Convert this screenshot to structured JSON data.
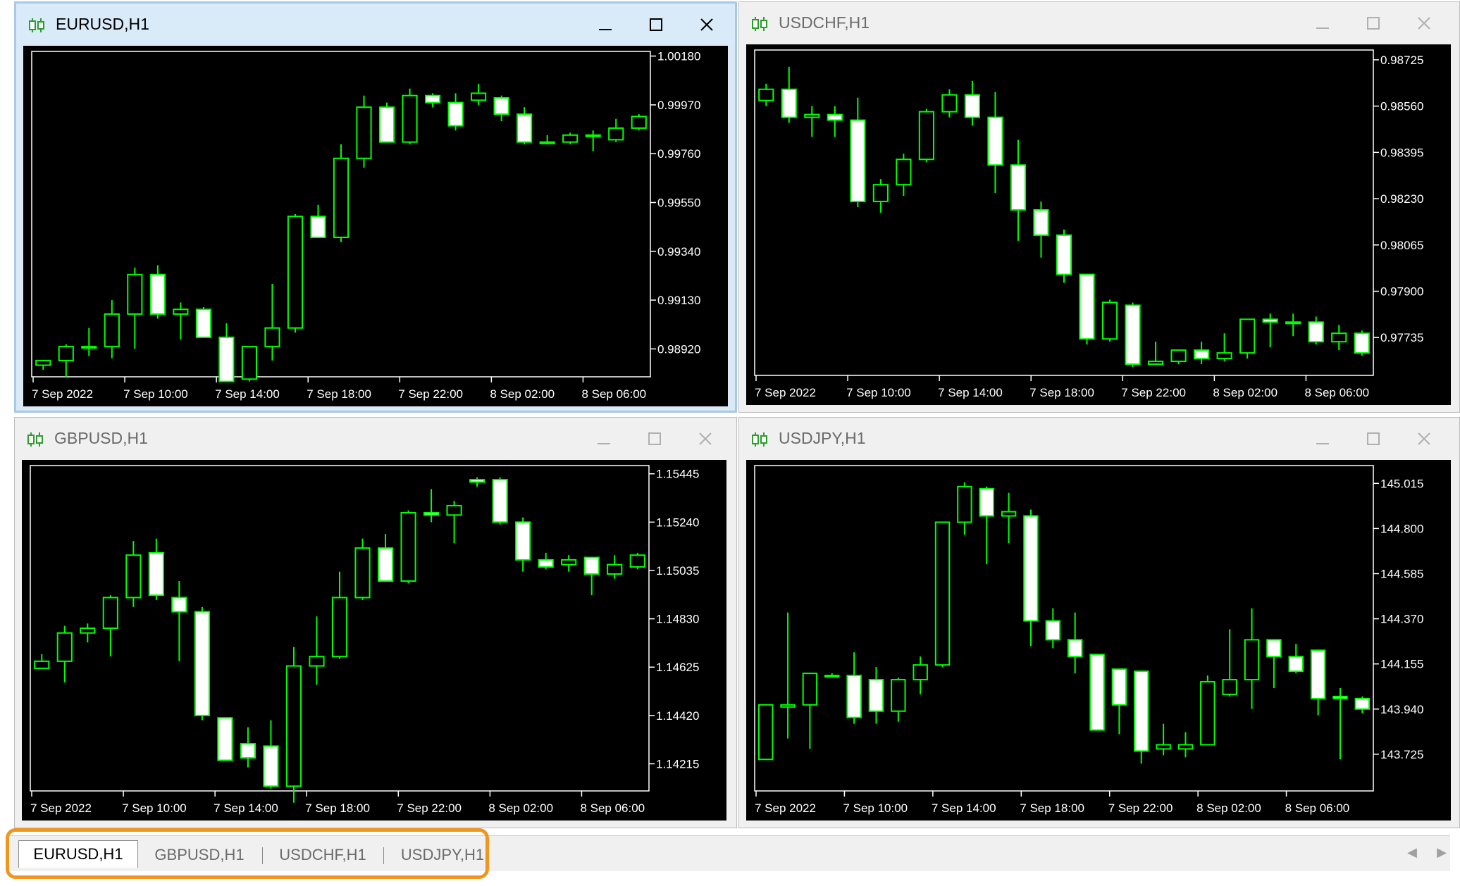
{
  "windows": [
    {
      "id": "eurusd",
      "title": "EURUSD,H1",
      "active": true,
      "price_labels": [
        "1.00180",
        "0.99970",
        "0.99760",
        "0.99550",
        "0.99340",
        "0.99130",
        "0.98920"
      ],
      "time_labels": [
        "7 Sep 2022",
        "7 Sep 10:00",
        "7 Sep 14:00",
        "7 Sep 18:00",
        "7 Sep 22:00",
        "8 Sep 02:00",
        "8 Sep 06:00"
      ],
      "chart_data": {
        "type": "candlestick",
        "y_axis": [
          0.988,
          1.002
        ],
        "candles": [
          [
            0.9885,
            0.9887,
            0.9883,
            0.9887
          ],
          [
            0.9887,
            0.9894,
            0.988,
            0.9893
          ],
          [
            0.9893,
            0.9901,
            0.9889,
            0.9893
          ],
          [
            0.9893,
            0.9913,
            0.9888,
            0.9907
          ],
          [
            0.9907,
            0.9927,
            0.9892,
            0.9924
          ],
          [
            0.9924,
            0.9928,
            0.9905,
            0.9907
          ],
          [
            0.9907,
            0.9912,
            0.9896,
            0.9909
          ],
          [
            0.9909,
            0.991,
            0.9897,
            0.9897
          ],
          [
            0.9897,
            0.9903,
            0.9878,
            0.9878
          ],
          [
            0.9879,
            0.9893,
            0.9878,
            0.9893
          ],
          [
            0.9893,
            0.992,
            0.9887,
            0.9901
          ],
          [
            0.9901,
            0.995,
            0.9899,
            0.9949
          ],
          [
            0.9949,
            0.9954,
            0.994,
            0.994
          ],
          [
            0.994,
            0.998,
            0.9938,
            0.9974
          ],
          [
            0.9974,
            1.0001,
            0.997,
            0.9996
          ],
          [
            0.9996,
            0.9998,
            0.9981,
            0.9981
          ],
          [
            0.9981,
            1.0004,
            0.998,
            1.0001
          ],
          [
            1.0001,
            1.0002,
            0.9996,
            0.9998
          ],
          [
            0.9998,
            1.0002,
            0.9986,
            0.9988
          ],
          [
            0.9999,
            1.0006,
            0.9997,
            1.0002
          ],
          [
            1.0,
            1.0001,
            0.999,
            0.9993
          ],
          [
            0.9993,
            0.9996,
            0.998,
            0.9981
          ],
          [
            0.9981,
            0.9984,
            0.998,
            0.9981
          ],
          [
            0.9981,
            0.9985,
            0.998,
            0.9984
          ],
          [
            0.9984,
            0.9986,
            0.9977,
            0.9984
          ],
          [
            0.9982,
            0.9991,
            0.9981,
            0.9987
          ],
          [
            0.9987,
            0.9993,
            0.9986,
            0.9992
          ]
        ]
      }
    },
    {
      "id": "usdchf",
      "title": "USDCHF,H1",
      "active": false,
      "price_labels": [
        "0.98725",
        "0.98560",
        "0.98395",
        "0.98230",
        "0.98065",
        "0.97900",
        "0.97735"
      ],
      "time_labels": [
        "7 Sep 2022",
        "7 Sep 10:00",
        "7 Sep 14:00",
        "7 Sep 18:00",
        "7 Sep 22:00",
        "8 Sep 02:00",
        "8 Sep 06:00"
      ],
      "chart_data": {
        "type": "candlestick",
        "y_axis": [
          0.976,
          0.9876
        ],
        "candles": [
          [
            0.9858,
            0.9864,
            0.9856,
            0.9862
          ],
          [
            0.9862,
            0.987,
            0.985,
            0.9852
          ],
          [
            0.9852,
            0.9856,
            0.9845,
            0.9853
          ],
          [
            0.9853,
            0.9856,
            0.9845,
            0.9851
          ],
          [
            0.9851,
            0.9859,
            0.982,
            0.9822
          ],
          [
            0.9822,
            0.983,
            0.9818,
            0.9828
          ],
          [
            0.9828,
            0.9839,
            0.9824,
            0.9837
          ],
          [
            0.9837,
            0.9855,
            0.9836,
            0.9854
          ],
          [
            0.9854,
            0.9862,
            0.9852,
            0.986
          ],
          [
            0.986,
            0.9865,
            0.9849,
            0.9852
          ],
          [
            0.9852,
            0.9861,
            0.9825,
            0.9835
          ],
          [
            0.9835,
            0.9844,
            0.9808,
            0.9819
          ],
          [
            0.9819,
            0.9822,
            0.9802,
            0.981
          ],
          [
            0.981,
            0.9812,
            0.9793,
            0.9796
          ],
          [
            0.9796,
            0.9796,
            0.9771,
            0.9773
          ],
          [
            0.9773,
            0.9787,
            0.9772,
            0.9786
          ],
          [
            0.9785,
            0.9786,
            0.9763,
            0.9764
          ],
          [
            0.9764,
            0.9772,
            0.9764,
            0.9765
          ],
          [
            0.9765,
            0.9769,
            0.9764,
            0.9769
          ],
          [
            0.9769,
            0.9772,
            0.9764,
            0.9766
          ],
          [
            0.9766,
            0.9775,
            0.9765,
            0.9768
          ],
          [
            0.9768,
            0.978,
            0.9766,
            0.978
          ],
          [
            0.978,
            0.9782,
            0.977,
            0.9779
          ],
          [
            0.9779,
            0.9782,
            0.9774,
            0.9779
          ],
          [
            0.9779,
            0.9781,
            0.9771,
            0.9772
          ],
          [
            0.9772,
            0.9778,
            0.9769,
            0.9775
          ],
          [
            0.9775,
            0.9776,
            0.9767,
            0.9768
          ]
        ]
      }
    },
    {
      "id": "gbpusd",
      "title": "GBPUSD,H1",
      "active": false,
      "price_labels": [
        "1.15445",
        "1.15240",
        "1.15035",
        "1.14830",
        "1.14625",
        "1.14420",
        "1.14215"
      ],
      "time_labels": [
        "7 Sep 2022",
        "7 Sep 10:00",
        "7 Sep 14:00",
        "7 Sep 18:00",
        "7 Sep 22:00",
        "8 Sep 02:00",
        "8 Sep 06:00"
      ],
      "chart_data": {
        "type": "candlestick",
        "y_axis": [
          1.141,
          1.1548
        ],
        "candles": [
          [
            1.1462,
            1.1468,
            1.1462,
            1.1465
          ],
          [
            1.1465,
            1.148,
            1.1456,
            1.1477
          ],
          [
            1.1477,
            1.1481,
            1.1473,
            1.1479
          ],
          [
            1.1479,
            1.1493,
            1.1467,
            1.1492
          ],
          [
            1.1492,
            1.1516,
            1.1488,
            1.151
          ],
          [
            1.1511,
            1.1517,
            1.1491,
            1.1493
          ],
          [
            1.1492,
            1.1499,
            1.1465,
            1.1486
          ],
          [
            1.1486,
            1.1488,
            1.144,
            1.1442
          ],
          [
            1.1441,
            1.143,
            1.1423,
            1.1423
          ],
          [
            1.143,
            1.1437,
            1.142,
            1.1424
          ],
          [
            1.1429,
            1.144,
            1.1411,
            1.1412
          ],
          [
            1.1412,
            1.1471,
            1.1405,
            1.1463
          ],
          [
            1.1463,
            1.1484,
            1.1455,
            1.1467
          ],
          [
            1.1467,
            1.1503,
            1.1466,
            1.1492
          ],
          [
            1.1492,
            1.1517,
            1.1491,
            1.1513
          ],
          [
            1.1513,
            1.1519,
            1.1499,
            1.1499
          ],
          [
            1.1499,
            1.1529,
            1.1498,
            1.1528
          ],
          [
            1.1528,
            1.1538,
            1.1524,
            1.1527
          ],
          [
            1.1527,
            1.1533,
            1.1515,
            1.1531
          ],
          [
            1.1542,
            1.1543,
            1.1539,
            1.1541
          ],
          [
            1.1542,
            1.1543,
            1.1523,
            1.1524
          ],
          [
            1.1524,
            1.1526,
            1.1503,
            1.1508
          ],
          [
            1.1508,
            1.1511,
            1.1504,
            1.1505
          ],
          [
            1.1506,
            1.151,
            1.1503,
            1.1508
          ],
          [
            1.1509,
            1.1509,
            1.1493,
            1.1502
          ],
          [
            1.1502,
            1.151,
            1.15,
            1.1506
          ],
          [
            1.1505,
            1.1511,
            1.1504,
            1.151
          ]
        ]
      }
    },
    {
      "id": "usdjpy",
      "title": "USDJPY,H1",
      "active": false,
      "price_labels": [
        "145.015",
        "144.800",
        "144.585",
        "144.370",
        "144.155",
        "143.940",
        "143.725"
      ],
      "time_labels": [
        "7 Sep 2022",
        "7 Sep 10:00",
        "7 Sep 14:00",
        "7 Sep 18:00",
        "7 Sep 22:00",
        "8 Sep 02:00",
        "8 Sep 06:00"
      ],
      "chart_data": {
        "type": "candlestick",
        "y_axis": [
          143.55,
          145.1
        ],
        "candles": [
          [
            143.7,
            143.96,
            143.7,
            143.96
          ],
          [
            143.95,
            144.4,
            143.8,
            143.96
          ],
          [
            143.96,
            144.08,
            143.75,
            144.11
          ],
          [
            144.1,
            144.11,
            144.09,
            144.1
          ],
          [
            144.1,
            144.21,
            143.87,
            143.9
          ],
          [
            144.08,
            144.14,
            143.87,
            143.93
          ],
          [
            143.93,
            144.09,
            143.88,
            144.08
          ],
          [
            144.08,
            144.19,
            144.01,
            144.15
          ],
          [
            144.15,
            144.83,
            144.14,
            144.83
          ],
          [
            144.83,
            145.02,
            144.77,
            145.0
          ],
          [
            144.99,
            145.0,
            144.63,
            144.86
          ],
          [
            144.86,
            144.97,
            144.73,
            144.88
          ],
          [
            144.86,
            144.89,
            144.24,
            144.36
          ],
          [
            144.36,
            144.42,
            144.23,
            144.27
          ],
          [
            144.27,
            144.4,
            144.11,
            144.19
          ],
          [
            144.2,
            144.2,
            143.84,
            143.84
          ],
          [
            144.13,
            144.13,
            143.82,
            143.96
          ],
          [
            144.12,
            144.1,
            143.68,
            143.74
          ],
          [
            143.75,
            143.87,
            143.72,
            143.77
          ],
          [
            143.75,
            143.83,
            143.71,
            143.77
          ],
          [
            143.77,
            144.1,
            143.77,
            144.07
          ],
          [
            144.01,
            144.32,
            144.0,
            144.08
          ],
          [
            144.08,
            144.42,
            143.94,
            144.27
          ],
          [
            144.27,
            144.27,
            144.04,
            144.19
          ],
          [
            144.19,
            144.25,
            144.11,
            144.12
          ],
          [
            144.22,
            144.22,
            143.91,
            143.99
          ],
          [
            144.0,
            144.04,
            143.7,
            143.99
          ],
          [
            143.99,
            144.0,
            143.92,
            143.94
          ]
        ]
      }
    }
  ],
  "tabs": [
    "EURUSD,H1",
    "GBPUSD,H1",
    "USDCHF,H1",
    "USDJPY,H1"
  ],
  "active_tab": "EURUSD,H1",
  "colors": {
    "chart_bg": "#000000",
    "candle_line": "#00ff00",
    "bull_body": "#000000",
    "bear_body": "#ffffff",
    "axis_text": "#ffffff",
    "highlight": "#f0961e"
  },
  "icons": {
    "chart_icon": "candlestick-chart-icon",
    "minimize": "minimize-icon",
    "maximize": "maximize-icon",
    "close": "close-icon",
    "scroll_left": "scroll-left-icon",
    "scroll_right": "scroll-right-icon"
  }
}
